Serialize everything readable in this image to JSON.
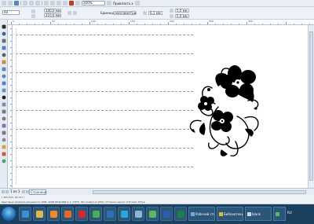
{
  "toolbar": {
    "zoom_value": "200%",
    "snap_label": "Привязать к"
  },
  "property_bar": {
    "paper_size": "A4",
    "width": "140,0 мм",
    "height": "210,0 мм",
    "units_label": "Единицы:",
    "units_value": "миллиметры",
    "nudge": "0,1 мм",
    "dup_x": "5,0 мм",
    "dup_y": "5,0 мм"
  },
  "ruler": {
    "h_numbers": [
      "0",
      "50",
      "100",
      "150",
      "200",
      "250",
      "300"
    ]
  },
  "page_nav": {
    "position": "1 из 1",
    "page_tab": "Страница 1"
  },
  "status": {
    "line1": "( 155,421; 19,117 )",
    "line2": "Цветовые профили документа: RGB: sRGB IEC61966-2.1; CMYK: ISO Coated v2 (ECI); Оттенки серого: Dot Gain 15% ▸"
  },
  "taskbar": {
    "apps": [
      {
        "name": "ie-app",
        "color": "#3a8fd8"
      },
      {
        "name": "explorer-app",
        "color": "#e2b64a"
      },
      {
        "name": "media-player-app",
        "color": "#f28a2c"
      },
      {
        "name": "firefox-app",
        "color": "#e46a28"
      },
      {
        "name": "opera-app",
        "color": "#d8262a"
      },
      {
        "name": "chrome-app",
        "color": "#4caf50"
      },
      {
        "name": "photoshop-app",
        "color": "#2f6fb8"
      },
      {
        "name": "skype-app",
        "color": "#29a8e0"
      },
      {
        "name": "calc-app",
        "color": "#8fb3d9"
      },
      {
        "name": "corel-app",
        "color": "#5cb85c"
      },
      {
        "name": "word-app",
        "color": "#2b5fad"
      },
      {
        "name": "excel-app",
        "color": "#1e7e45"
      }
    ],
    "tasks": [
      {
        "label": "Рабочий стол",
        "color": "#6fa8dc"
      },
      {
        "label": "Библиотеки",
        "color": "#e2b64a"
      },
      {
        "label": "blank",
        "color": "#cfd8e3"
      },
      {
        "label": "",
        "color": "#5cb85c"
      }
    ],
    "lang": "RU",
    "clock": ""
  },
  "colors": {
    "artwork": "#000000",
    "canvas": "#ffffff",
    "taskbar": "#1b3f5e"
  }
}
